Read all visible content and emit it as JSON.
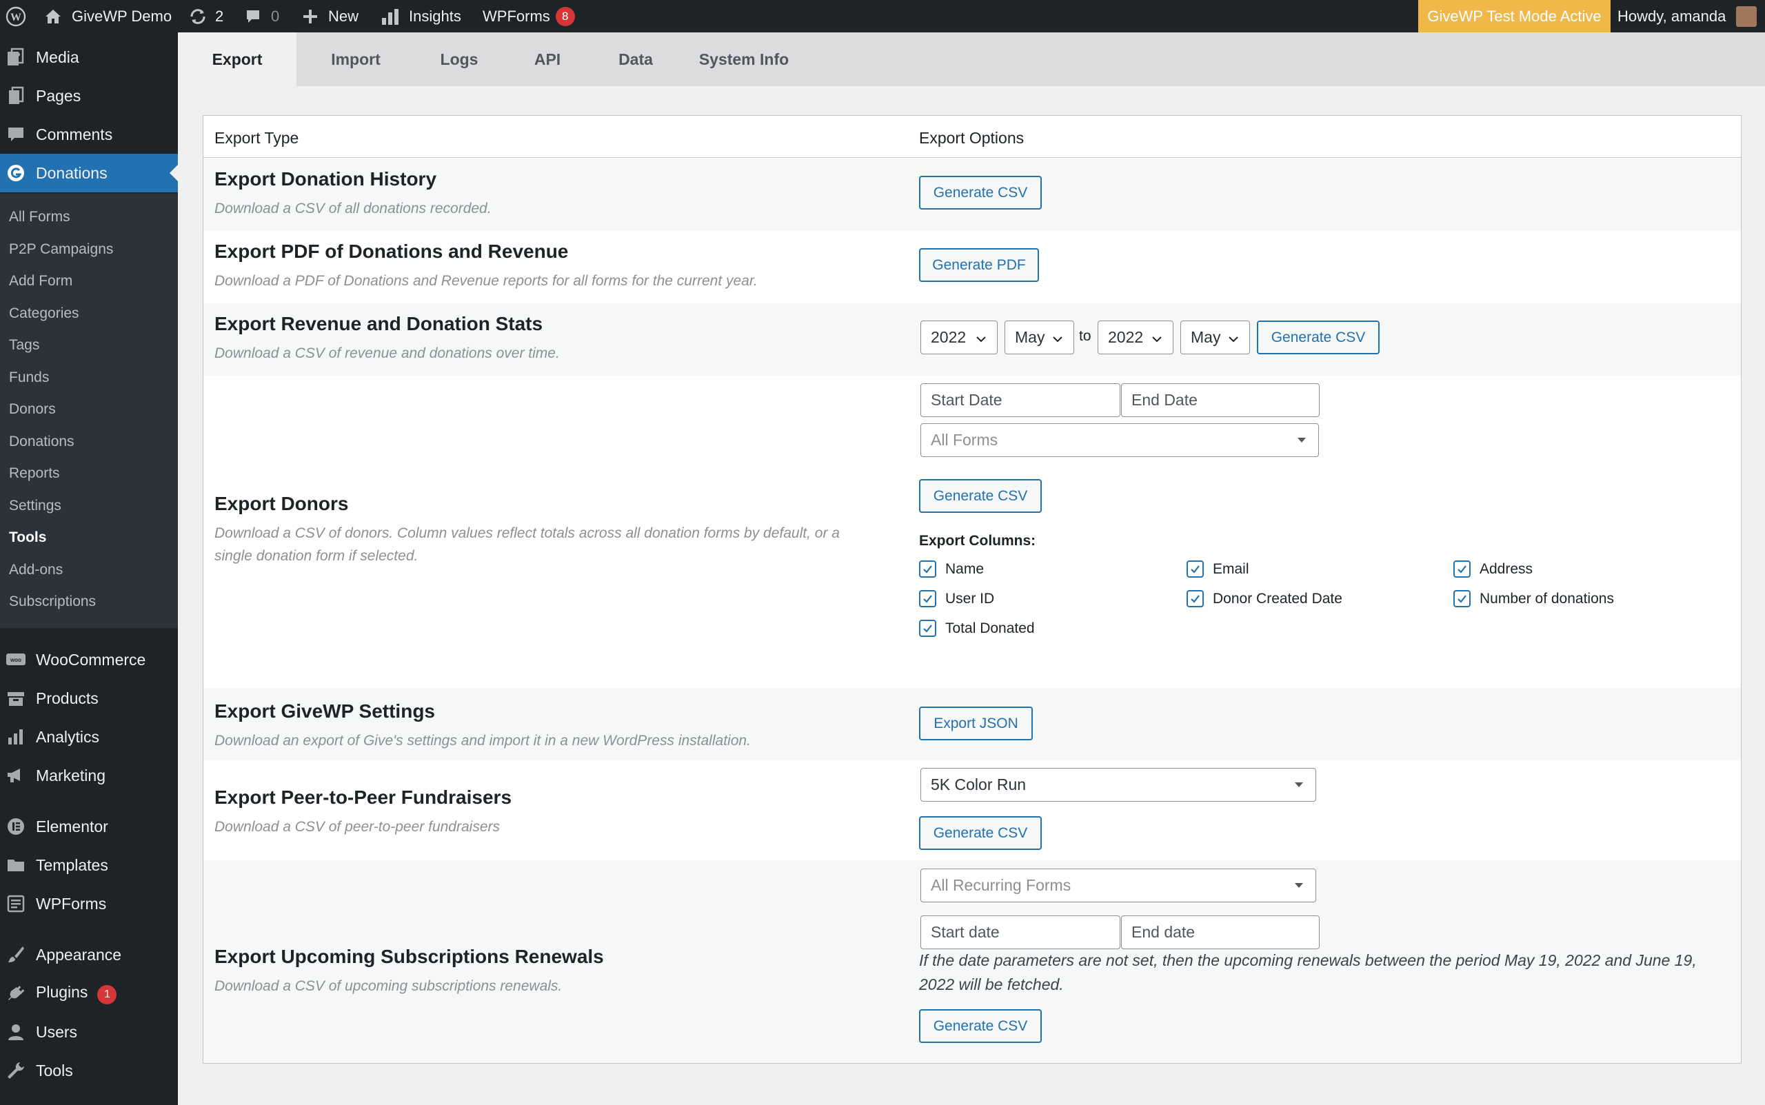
{
  "adminbar": {
    "site_name": "GiveWP Demo",
    "updates_count": "2",
    "comments_count": "0",
    "new_label": "New",
    "insights_label": "Insights",
    "wpforms_label": "WPForms",
    "wpforms_badge": "8",
    "test_mode": "GiveWP Test Mode Active",
    "howdy": "Howdy, amanda"
  },
  "sidebar": {
    "top_items": [
      {
        "label": "Media",
        "icon": "media-icon"
      },
      {
        "label": "Pages",
        "icon": "pages-icon"
      },
      {
        "label": "Comments",
        "icon": "comments-icon"
      },
      {
        "label": "Donations",
        "icon": "give-icon"
      }
    ],
    "submenu": [
      "All Forms",
      "P2P Campaigns",
      "Add Form",
      "Categories",
      "Tags",
      "Funds",
      "Donors",
      "Donations",
      "Reports",
      "Settings",
      "Tools",
      "Add-ons",
      "Subscriptions"
    ],
    "bottom_items": [
      {
        "label": "WooCommerce",
        "icon": "woo-icon"
      },
      {
        "label": "Products",
        "icon": "products-icon"
      },
      {
        "label": "Analytics",
        "icon": "analytics-icon"
      },
      {
        "label": "Marketing",
        "icon": "megaphone-icon"
      },
      {
        "label": "Elementor",
        "icon": "elementor-icon"
      },
      {
        "label": "Templates",
        "icon": "folder-icon"
      },
      {
        "label": "WPForms",
        "icon": "wpforms-icon"
      },
      {
        "label": "Appearance",
        "icon": "brush-icon"
      },
      {
        "label": "Plugins",
        "icon": "plugin-icon"
      },
      {
        "label": "Users",
        "icon": "users-icon"
      },
      {
        "label": "Tools",
        "icon": "wrench-icon"
      }
    ],
    "plugins_badge": "1"
  },
  "tabs": [
    "Export",
    "Import",
    "Logs",
    "API",
    "Data",
    "System Info"
  ],
  "table": {
    "col_type": "Export Type",
    "col_options": "Export Options",
    "rows": {
      "donation_history": {
        "title": "Export Donation History",
        "desc": "Download a CSV of all donations recorded.",
        "button": "Generate CSV"
      },
      "pdf": {
        "title": "Export PDF of Donations and Revenue",
        "desc": "Download a PDF of Donations and Revenue reports for all forms for the current year.",
        "button": "Generate PDF"
      },
      "stats": {
        "title": "Export Revenue and Donation Stats",
        "desc": "Download a CSV of revenue and donations over time.",
        "start_year": "2022",
        "start_month": "May",
        "to": "to",
        "end_year": "2022",
        "end_month": "May",
        "button": "Generate CSV"
      },
      "donors": {
        "title": "Export Donors",
        "desc_line1": "Download a CSV of donors. Column values reflect totals across all donation forms by default, or a",
        "desc_line2": "single donation form if selected.",
        "start_placeholder": "Start Date",
        "end_placeholder": "End Date",
        "form_select": "All Forms",
        "button": "Generate CSV",
        "columns_label": "Export Columns:",
        "columns": [
          "Name",
          "Email",
          "Address",
          "User ID",
          "Donor Created Date",
          "Number of donations",
          "Total Donated"
        ]
      },
      "settings": {
        "title": "Export GiveWP Settings",
        "desc": "Download an export of Give's settings and import it in a new WordPress installation.",
        "button": "Export JSON"
      },
      "p2p": {
        "title": "Export Peer-to-Peer Fundraisers",
        "desc": "Download a CSV of peer-to-peer fundraisers",
        "select": "5K Color Run",
        "button": "Generate CSV"
      },
      "subscriptions": {
        "title": "Export Upcoming Subscriptions Renewals",
        "desc": "Download a CSV of upcoming subscriptions renewals.",
        "select": "All Recurring Forms",
        "start_placeholder": "Start date",
        "end_placeholder": "End date",
        "note_line1": "If the date parameters are not set, then the upcoming renewals between the period May 19, 2022 and June 19,",
        "note_line2": "2022 will be fetched.",
        "button": "Generate CSV"
      }
    }
  }
}
